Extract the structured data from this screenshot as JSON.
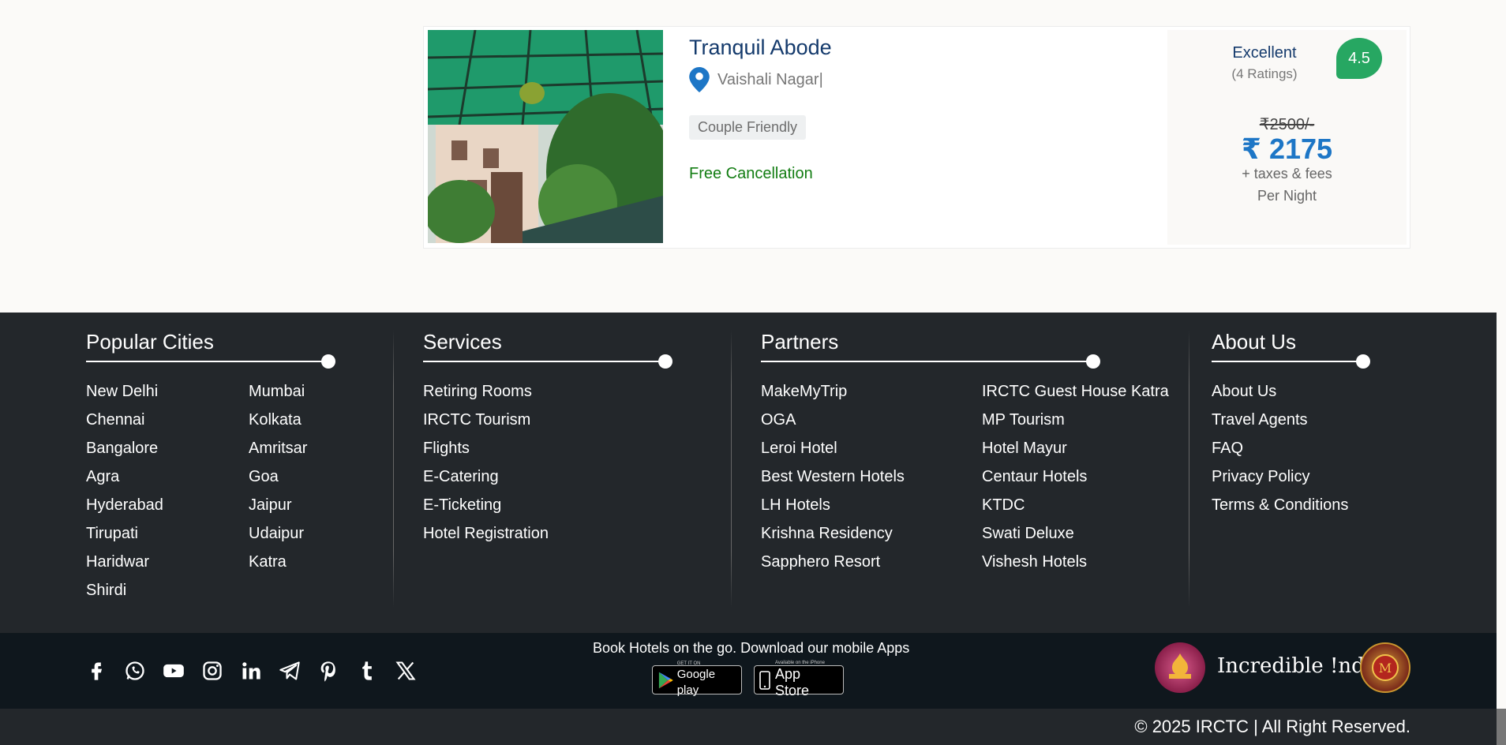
{
  "hotel": {
    "name": "Tranquil Abode",
    "location": "Vaishali Nagar|",
    "tag": "Couple Friendly",
    "cancellation": "Free Cancellation",
    "rating_word": "Excellent",
    "rating_count": "(4 Ratings)",
    "rating_score": "4.5",
    "old_price": "₹2500/-",
    "price": "₹ 2175",
    "taxes": "+ taxes & fees",
    "per_night": "Per Night"
  },
  "footer": {
    "popular_cities": {
      "title": "Popular Cities",
      "left": [
        "New Delhi",
        "Chennai",
        "Bangalore",
        "Agra",
        "Hyderabad",
        "Tirupati",
        "Haridwar",
        "Shirdi"
      ],
      "right": [
        "Mumbai",
        "Kolkata",
        "Amritsar",
        "Goa",
        "Jaipur",
        "Udaipur",
        "Katra"
      ]
    },
    "services": {
      "title": "Services",
      "items": [
        "Retiring Rooms",
        "IRCTC Tourism",
        "Flights",
        "E-Catering",
        "E-Ticketing",
        "Hotel Registration"
      ]
    },
    "partners": {
      "title": "Partners",
      "left": [
        "MakeMyTrip",
        "OGA",
        "Leroi Hotel",
        "Best Western Hotels",
        "LH Hotels",
        "Krishna Residency",
        "Sapphero Resort"
      ],
      "right": [
        "IRCTC Guest House Katra",
        "MP Tourism",
        "Hotel Mayur",
        "Centaur Hotels",
        "KTDC",
        "Swati Deluxe",
        "Vishesh Hotels"
      ]
    },
    "about": {
      "title": "About Us",
      "items": [
        "About Us",
        "Travel Agents",
        "FAQ",
        "Privacy Policy",
        "Terms & Conditions"
      ]
    },
    "apps_text": "Book Hotels on the go. Download our mobile Apps",
    "google_play": {
      "small": "GET IT ON",
      "big": "Google play"
    },
    "app_store": {
      "small": "Available on the iPhone",
      "big": "App Store"
    },
    "incredible_india": "Incredible !ndia",
    "copyright": "© 2025 IRCTC | All Right Reserved."
  },
  "colors": {
    "footer_bg": "#23272b",
    "bottom_bar": "#0f171d",
    "price_blue": "#1d76c6",
    "rating_green": "#27a762",
    "cancel_green": "#137d13"
  }
}
